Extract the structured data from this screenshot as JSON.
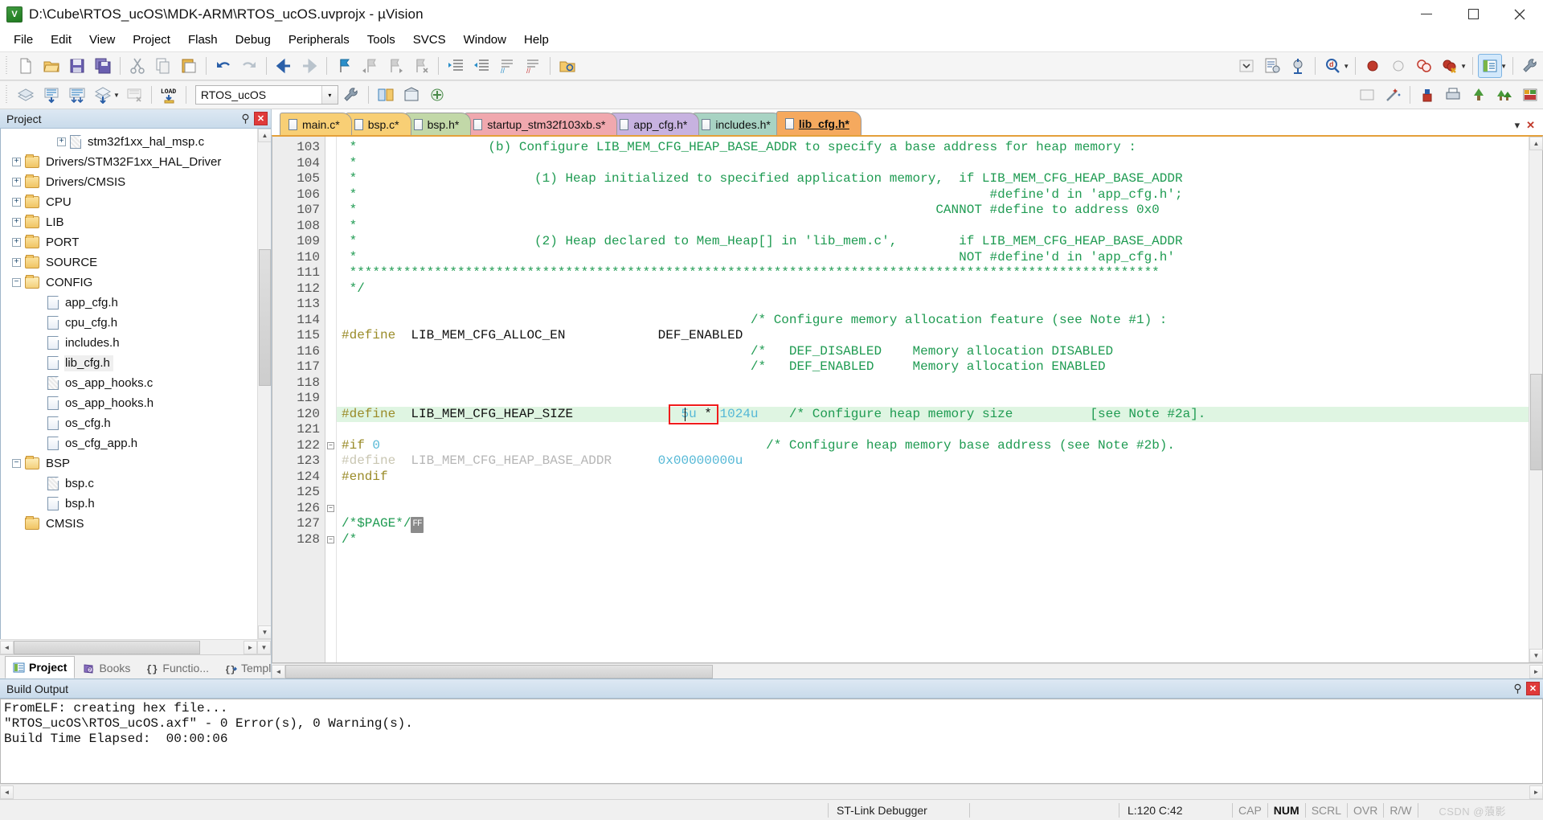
{
  "window": {
    "title": "D:\\Cube\\RTOS_ucOS\\MDK-ARM\\RTOS_ucOS.uvprojx - µVision",
    "app_icon": "uvision-logo-icon",
    "minimize": "—",
    "maximize": "▢",
    "close": "✕"
  },
  "menu": {
    "items": [
      {
        "label": "File"
      },
      {
        "label": "Edit"
      },
      {
        "label": "View"
      },
      {
        "label": "Project"
      },
      {
        "label": "Flash"
      },
      {
        "label": "Debug"
      },
      {
        "label": "Peripherals"
      },
      {
        "label": "Tools"
      },
      {
        "label": "SVCS"
      },
      {
        "label": "Window"
      },
      {
        "label": "Help"
      }
    ]
  },
  "toolbar_file": {
    "buttons": [
      {
        "name": "new-file-icon",
        "title": "New"
      },
      {
        "name": "open-file-icon",
        "title": "Open"
      },
      {
        "name": "save-icon",
        "title": "Save"
      },
      {
        "name": "save-all-icon",
        "title": "Save All"
      },
      {
        "name": "cut-icon",
        "title": "Cut"
      },
      {
        "name": "copy-icon",
        "title": "Copy"
      },
      {
        "name": "paste-icon",
        "title": "Paste"
      },
      {
        "name": "undo-icon",
        "title": "Undo"
      },
      {
        "name": "redo-icon",
        "title": "Redo"
      },
      {
        "name": "navigate-back-icon",
        "title": "Back"
      },
      {
        "name": "navigate-forward-icon",
        "title": "Forward"
      },
      {
        "name": "bookmark-toggle-icon",
        "title": "Insert/Remove Bookmark"
      },
      {
        "name": "bookmark-prev-icon",
        "title": "Previous Bookmark"
      },
      {
        "name": "bookmark-next-icon",
        "title": "Next Bookmark"
      },
      {
        "name": "bookmark-clear-icon",
        "title": "Clear All Bookmarks"
      },
      {
        "name": "indent-icon",
        "title": "Indent"
      },
      {
        "name": "outdent-icon",
        "title": "Outdent"
      },
      {
        "name": "comment-icon",
        "title": "Comment"
      },
      {
        "name": "uncomment-icon",
        "title": "Uncomment"
      },
      {
        "name": "find-in-files-icon",
        "title": "Find in Files"
      },
      {
        "name": "dropdown-caret-icon",
        "title": "More"
      },
      {
        "name": "configure-icon",
        "title": "Configuration Wizard"
      },
      {
        "name": "debug-start-icon",
        "title": "Start/Stop Debug Session"
      },
      {
        "name": "search-target-icon",
        "title": "Find"
      },
      {
        "name": "insert-breakpoint-icon",
        "title": "Insert/Remove Breakpoint"
      },
      {
        "name": "disable-breakpoint-icon",
        "title": "Enable/Disable Breakpoint"
      },
      {
        "name": "disable-all-breakpoints-icon",
        "title": "Disable All Breakpoints"
      },
      {
        "name": "kill-all-breakpoints-icon",
        "title": "Kill All Breakpoints"
      },
      {
        "name": "window-layout-icon",
        "title": "Window Layout"
      },
      {
        "name": "options-target-icon",
        "title": "Options for Target"
      }
    ]
  },
  "toolbar_build": {
    "buttons": [
      {
        "name": "translate-icon",
        "title": "Translate"
      },
      {
        "name": "build-icon",
        "title": "Build"
      },
      {
        "name": "rebuild-icon",
        "title": "Rebuild"
      },
      {
        "name": "batch-build-icon",
        "title": "Batch Build"
      },
      {
        "name": "stop-build-icon",
        "title": "Stop Build"
      },
      {
        "name": "load-icon",
        "title": "LOAD"
      },
      {
        "name": "target-options-icon",
        "title": "Target Options"
      },
      {
        "name": "manage-project-icon",
        "title": "Manage Project Items"
      },
      {
        "name": "pack-installer-icon",
        "title": "Pack Installer"
      },
      {
        "name": "run-to-main-icon",
        "title": "Run"
      },
      {
        "name": "svcs-icon",
        "title": "SVCS"
      }
    ],
    "target_select": {
      "value": "RTOS_ucOS",
      "caret": "▾"
    }
  },
  "project_panel": {
    "title": "Project",
    "pin_glyph": "⚲",
    "close_glyph": "✕",
    "tree": [
      {
        "label": "stm32f1xx_hal_msp.c",
        "type": "file-c",
        "indent": 3,
        "expander": "+",
        "selected": false
      },
      {
        "label": "Drivers/STM32F1xx_HAL_Driver",
        "type": "folder",
        "indent": 1,
        "expander": "+",
        "selected": false
      },
      {
        "label": "Drivers/CMSIS",
        "type": "folder",
        "indent": 1,
        "expander": "+",
        "selected": false
      },
      {
        "label": "CPU",
        "type": "folder",
        "indent": 1,
        "expander": "+",
        "selected": false
      },
      {
        "label": "LIB",
        "type": "folder",
        "indent": 1,
        "expander": "+",
        "selected": false
      },
      {
        "label": "PORT",
        "type": "folder",
        "indent": 1,
        "expander": "+",
        "selected": false
      },
      {
        "label": "SOURCE",
        "type": "folder",
        "indent": 1,
        "expander": "+",
        "selected": false
      },
      {
        "label": "CONFIG",
        "type": "folder-open",
        "indent": 1,
        "expander": "−",
        "selected": false
      },
      {
        "label": "app_cfg.h",
        "type": "file-h",
        "indent": 2,
        "expander": "",
        "selected": false
      },
      {
        "label": "cpu_cfg.h",
        "type": "file-h",
        "indent": 2,
        "expander": "",
        "selected": false
      },
      {
        "label": "includes.h",
        "type": "file-h",
        "indent": 2,
        "expander": "",
        "selected": false
      },
      {
        "label": "lib_cfg.h",
        "type": "file-h",
        "indent": 2,
        "expander": "",
        "selected": true
      },
      {
        "label": "os_app_hooks.c",
        "type": "file-c",
        "indent": 2,
        "expander": "",
        "selected": false
      },
      {
        "label": "os_app_hooks.h",
        "type": "file-h",
        "indent": 2,
        "expander": "",
        "selected": false
      },
      {
        "label": "os_cfg.h",
        "type": "file-h",
        "indent": 2,
        "expander": "",
        "selected": false
      },
      {
        "label": "os_cfg_app.h",
        "type": "file-h",
        "indent": 2,
        "expander": "",
        "selected": false
      },
      {
        "label": "BSP",
        "type": "folder-open",
        "indent": 1,
        "expander": "−",
        "selected": false
      },
      {
        "label": "bsp.c",
        "type": "file-c",
        "indent": 2,
        "expander": "",
        "selected": false
      },
      {
        "label": "bsp.h",
        "type": "file-h",
        "indent": 2,
        "expander": "",
        "selected": false
      },
      {
        "label": "CMSIS",
        "type": "folder",
        "indent": 1,
        "expander": "",
        "selected": false
      }
    ],
    "tabs": [
      {
        "label": "Project",
        "icon": "project-icon",
        "active": true
      },
      {
        "label": "Books",
        "icon": "books-icon",
        "active": false
      },
      {
        "label": "Functio...",
        "icon": "functions-icon",
        "active": false
      },
      {
        "label": "Templa...",
        "icon": "templates-icon",
        "active": false
      }
    ]
  },
  "editor": {
    "tabs": [
      {
        "label": "main.c*",
        "color": "#f8cf75",
        "active": false
      },
      {
        "label": "bsp.c*",
        "color": "#f8cf75",
        "active": false
      },
      {
        "label": "bsp.h*",
        "color": "#c2d8a8",
        "active": false
      },
      {
        "label": "startup_stm32f103xb.s*",
        "color": "#f0a8ae",
        "active": false
      },
      {
        "label": "app_cfg.h*",
        "color": "#c7b2e0",
        "active": false
      },
      {
        "label": "includes.h*",
        "color": "#a8d3c3",
        "active": false
      },
      {
        "label": "lib_cfg.h*",
        "color": "#f5a95e",
        "active": true
      }
    ],
    "tab_controls": {
      "dropdown": "▾",
      "close": "✕"
    },
    "first_line_number": 103,
    "lines": [
      {
        "n": 103,
        "segs": [
          {
            "t": " *                 (b) Configure LIB_MEM_CFG_HEAP_BASE_ADDR to specify a base address for heap memory :",
            "c": "cm"
          }
        ]
      },
      {
        "n": 104,
        "segs": [
          {
            "t": " *",
            "c": "cm"
          }
        ]
      },
      {
        "n": 105,
        "segs": [
          {
            "t": " *                       (1) Heap initialized to specified application memory,  if LIB_MEM_CFG_HEAP_BASE_ADDR",
            "c": "cm"
          }
        ]
      },
      {
        "n": 106,
        "segs": [
          {
            "t": " *                                                                                  #define'd in 'app_cfg.h';",
            "c": "cm"
          }
        ]
      },
      {
        "n": 107,
        "segs": [
          {
            "t": " *                                                                           CANNOT #define to address 0x0",
            "c": "cm"
          }
        ]
      },
      {
        "n": 108,
        "segs": [
          {
            "t": " *",
            "c": "cm"
          }
        ]
      },
      {
        "n": 109,
        "segs": [
          {
            "t": " *                       (2) Heap declared to Mem_Heap[] in 'lib_mem.c',        if LIB_MEM_CFG_HEAP_BASE_ADDR",
            "c": "cm"
          }
        ]
      },
      {
        "n": 110,
        "segs": [
          {
            "t": " *                                                                              NOT #define'd in 'app_cfg.h'",
            "c": "cm"
          }
        ]
      },
      {
        "n": 111,
        "segs": [
          {
            "t": " *********************************************************************************************************",
            "c": "cm"
          }
        ]
      },
      {
        "n": 112,
        "segs": [
          {
            "t": " */",
            "c": "cm"
          }
        ]
      },
      {
        "n": 113,
        "segs": []
      },
      {
        "n": 114,
        "segs": [
          {
            "t": "                                                     /* Configure memory allocation feature (see Note #1) :",
            "c": "cm"
          }
        ]
      },
      {
        "n": 115,
        "segs": [
          {
            "t": "#define",
            "c": "pp"
          },
          {
            "t": "  LIB_MEM_CFG_ALLOC_EN            DEF_ENABLED",
            "c": "idt"
          }
        ]
      },
      {
        "n": 116,
        "segs": [
          {
            "t": "                                                     /*   DEF_DISABLED    Memory allocation DISABLED",
            "c": "cm"
          }
        ]
      },
      {
        "n": 117,
        "segs": [
          {
            "t": "                                                     /*   DEF_ENABLED     Memory allocation ENABLED",
            "c": "cm"
          }
        ]
      },
      {
        "n": 118,
        "segs": []
      },
      {
        "n": 119,
        "segs": []
      },
      {
        "n": 120,
        "highlight": true,
        "segs": [
          {
            "t": "#define",
            "c": "pp"
          },
          {
            "t": "  LIB_MEM_CFG_HEAP_SIZE              ",
            "c": "idt"
          },
          {
            "t": "5u",
            "c": "num"
          },
          {
            "t": " * ",
            "c": "idt"
          },
          {
            "t": "1024u",
            "c": "num"
          },
          {
            "t": "    ",
            "c": "idt"
          },
          {
            "t": "/* Configure heap memory size          [see Note #2a].",
            "c": "cm"
          }
        ]
      },
      {
        "n": 121,
        "segs": []
      },
      {
        "n": 122,
        "fold": "−",
        "segs": [
          {
            "t": "#if",
            "c": "pp"
          },
          {
            "t": " ",
            "c": "idt"
          },
          {
            "t": "0",
            "c": "num"
          },
          {
            "t": "                                                  ",
            "c": "idt"
          },
          {
            "t": "/* Configure heap memory base address (see Note #2b).",
            "c": "cm"
          }
        ]
      },
      {
        "n": 123,
        "segs": [
          {
            "t": "#define",
            "c": "pp-dim"
          },
          {
            "t": "  LIB_MEM_CFG_HEAP_BASE_ADDR      ",
            "c": "dim"
          },
          {
            "t": "0x00000000u",
            "c": "num"
          }
        ]
      },
      {
        "n": 124,
        "segs": [
          {
            "t": "#endif",
            "c": "pp"
          }
        ]
      },
      {
        "n": 125,
        "segs": []
      },
      {
        "n": 126,
        "fold": "−",
        "segs": []
      },
      {
        "n": 127,
        "segs": [
          {
            "t": "/*$PAGE*/",
            "c": "cm"
          },
          {
            "t": "FF",
            "c": "ffbadge"
          }
        ]
      },
      {
        "n": 128,
        "fold": "−",
        "segs": [
          {
            "t": "/*",
            "c": "cm"
          }
        ]
      }
    ],
    "selection_box": {
      "label": "selected-token-highlight",
      "text": "5u *",
      "color": "#f01c1c"
    },
    "cursor_after": "5"
  },
  "build_output": {
    "title": "Build Output",
    "pin_glyph": "⚲",
    "close_glyph": "✕",
    "lines": [
      "FromELF: creating hex file...",
      "\"RTOS_ucOS\\RTOS_ucOS.axf\" - 0 Error(s), 0 Warning(s).",
      "Build Time Elapsed:  00:00:06"
    ]
  },
  "status_bar": {
    "debugger": "ST-Link Debugger",
    "position": "L:120 C:42",
    "indicators": [
      {
        "label": "CAP",
        "on": false
      },
      {
        "label": "NUM",
        "on": true
      },
      {
        "label": "SCRL",
        "on": false
      },
      {
        "label": "OVR",
        "on": false
      },
      {
        "label": "R/W",
        "on": false
      }
    ],
    "watermark": "CSDN @蒗影"
  }
}
